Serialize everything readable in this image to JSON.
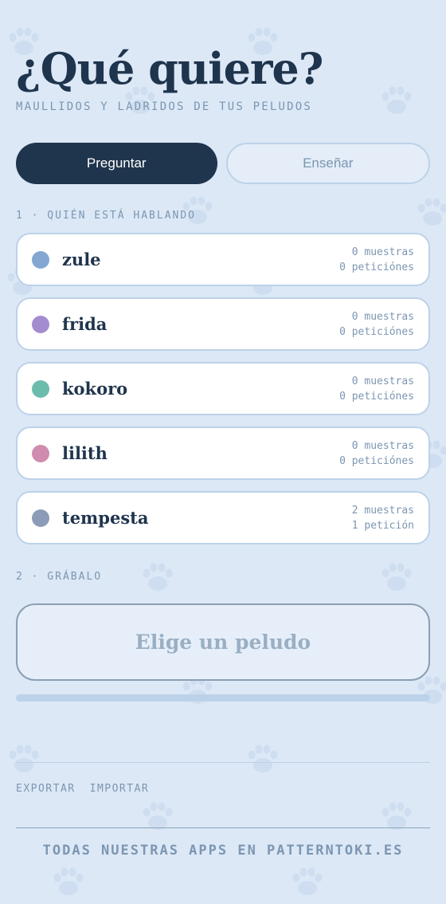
{
  "header": {
    "title": "¿Qué quiere?",
    "subtitle": "MAULLIDOS Y LADRIDOS DE TUS PELUDOS"
  },
  "tabs": {
    "ask": "Preguntar",
    "teach": "Enseñar",
    "active": "ask"
  },
  "section1": {
    "label": "1 · QUIÉN ESTÁ HABLANDO"
  },
  "pets": [
    {
      "name": "zule",
      "color": "#82a8d2",
      "samples": "0 muestras",
      "requests": "0 peticiónes"
    },
    {
      "name": "frida",
      "color": "#a48cd0",
      "samples": "0 muestras",
      "requests": "0 peticiónes"
    },
    {
      "name": "kokoro",
      "color": "#6cbcac",
      "samples": "0 muestras",
      "requests": "0 peticiónes"
    },
    {
      "name": "lilith",
      "color": "#cf8cae",
      "samples": "0 muestras",
      "requests": "0 peticiónes"
    },
    {
      "name": "tempesta",
      "color": "#8c9cb8",
      "samples": "2 muestras",
      "requests": "1 petición"
    }
  ],
  "section2": {
    "label": "2 · GRÁBALO"
  },
  "record": {
    "label": "Elige un peludo",
    "progress": 0
  },
  "links": {
    "export": "EXPORTAR",
    "import": "IMPORTAR"
  },
  "footer": {
    "text": "TODAS NUESTRAS APPS EN PATTERNTOKI.ES"
  },
  "colors": {
    "accent": "#1f344d",
    "background": "#dce8f6",
    "muted": "#7c96b2"
  }
}
